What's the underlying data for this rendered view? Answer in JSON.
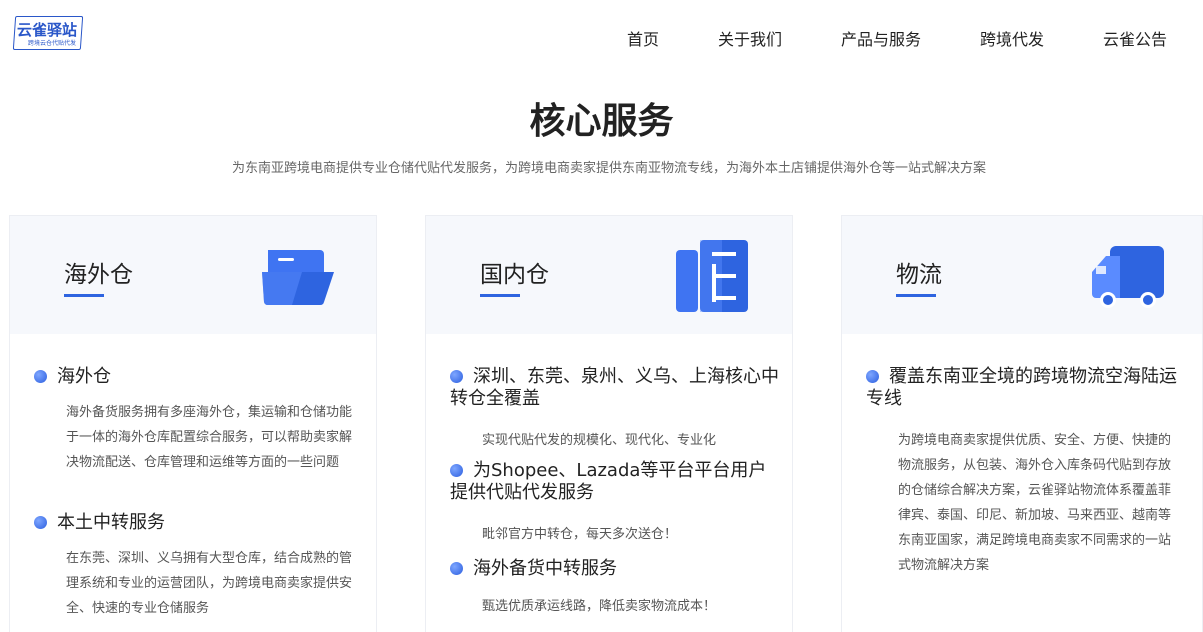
{
  "header": {
    "logo_text": "云雀驿站",
    "logo_sub": "跨境云仓代贴代发",
    "nav": [
      "首页",
      "关于我们",
      "产品与服务",
      "跨境代发",
      "云雀公告"
    ]
  },
  "section": {
    "title": "核心服务",
    "subtitle": "为东南亚跨境电商提供专业仓储代贴代发服务，为跨境电商卖家提供东南亚物流专线，为海外本土店铺提供海外仓等一站式解决方案"
  },
  "cards": [
    {
      "title": "海外仓",
      "icon": "folder-icon",
      "items": [
        {
          "title": "海外仓",
          "desc": "海外备货服务拥有多座海外仓，集运输和仓储功能于一体的海外仓库配置综合服务，可以帮助卖家解决物流配送、仓库管理和运维等方面的一些问题"
        },
        {
          "title": "本土中转服务",
          "desc": "在东莞、深圳、义乌拥有大型仓库，结合成熟的管理系统和专业的运营团队，为跨境电商卖家提供安全、快速的专业仓储服务"
        }
      ]
    },
    {
      "title": "国内仓",
      "icon": "warehouse-shelf-icon",
      "items": [
        {
          "title": "深圳、东莞、泉州、义乌、上海核心中转仓全覆盖",
          "desc": "实现代贴代发的规模化、现代化、专业化"
        },
        {
          "title": "为Shopee、Lazada等平台平台用户提供代贴代发服务",
          "desc": "毗邻官方中转仓，每天多次送仓！"
        },
        {
          "title": "海外备货中转服务",
          "desc": "甄选优质承运线路，降低卖家物流成本！"
        }
      ]
    },
    {
      "title": "物流",
      "icon": "truck-icon",
      "items": [
        {
          "title": "覆盖东南亚全境的跨境物流空海陆运专线",
          "desc": "为跨境电商卖家提供优质、安全、方便、快捷的物流服务，从包装、海外仓入库条码代贴到存放的仓储综合解决方案，云雀驿站物流体系覆盖菲律宾、泰国、印尼、新加坡、马来西亚、越南等东南亚国家，满足跨境电商卖家不同需求的一站式物流解决方案"
        }
      ]
    }
  ],
  "colors": {
    "accent": "#2e64e0",
    "icon_blue": "#3a6ef0",
    "card_head_bg": "#f6f8fc"
  }
}
